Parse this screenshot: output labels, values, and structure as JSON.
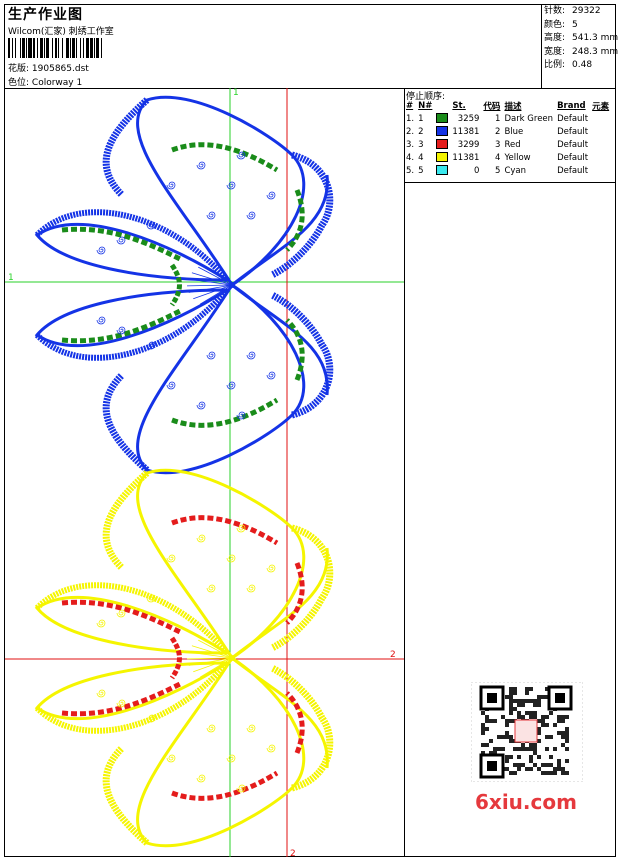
{
  "header": {
    "title": "生产作业图",
    "company": "Wilcom(汇家) 刺绣工作室",
    "design_label": "花版:",
    "design_value": "1905865.dst",
    "colorway_label": "色位:",
    "colorway_value": "Colorway 1"
  },
  "stats": {
    "stitches_label": "针数:",
    "stitches_value": "29322",
    "colors_label": "颜色:",
    "colors_value": "5",
    "height_label": "高度:",
    "height_value": "541.3 mm",
    "width_label": "宽度:",
    "width_value": "248.3 mm",
    "scale_label": "比例:",
    "scale_value": "0.48"
  },
  "stop_sequence": {
    "title": "停止顺序:",
    "headers": [
      "#",
      "N#",
      "St.",
      "代码",
      "描述",
      "Brand",
      "元素"
    ],
    "rows": [
      {
        "num": "1.",
        "n": "1",
        "color": "#1a8c1a",
        "st": "3259",
        "code": "1",
        "desc": "Dark Green",
        "brand": "Default"
      },
      {
        "num": "2.",
        "n": "2",
        "color": "#1433e6",
        "st": "11381",
        "code": "2",
        "desc": "Blue",
        "brand": "Default"
      },
      {
        "num": "3.",
        "n": "3",
        "color": "#e41c1c",
        "st": "3299",
        "code": "3",
        "desc": "Red",
        "brand": "Default"
      },
      {
        "num": "4.",
        "n": "4",
        "color": "#f5f500",
        "st": "11381",
        "code": "4",
        "desc": "Yellow",
        "brand": "Default"
      },
      {
        "num": "5.",
        "n": "5",
        "color": "#3ae8ee",
        "st": "0",
        "code": "5",
        "desc": "Cyan",
        "brand": "Default"
      }
    ]
  },
  "guides": {
    "label_1_top": "1",
    "label_1_left": "1",
    "label_2_right": "2",
    "label_2_bottom": "2"
  },
  "watermark": "6xiu.com",
  "colors": {
    "blue": "#1433e6",
    "green": "#1a8c1a",
    "red": "#e41c1c",
    "yellow": "#f5f500",
    "guide_green": "#28d228",
    "guide_red": "#e01010"
  }
}
